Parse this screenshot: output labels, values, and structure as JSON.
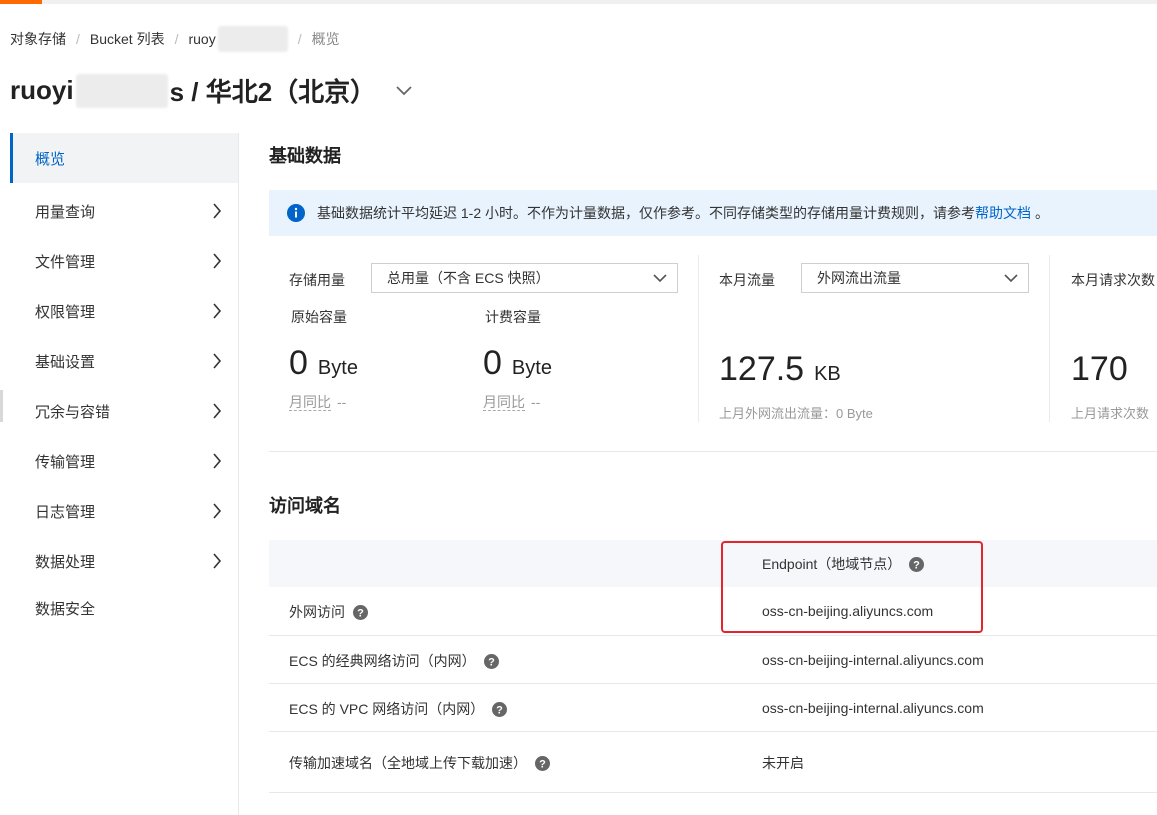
{
  "breadcrumb": {
    "items": [
      "对象存储",
      "Bucket 列表",
      "ruoy"
    ],
    "current": "概览"
  },
  "page_title": {
    "prefix": "ruoyi",
    "suffix": "s / 华北2（北京）"
  },
  "sidebar": {
    "items": [
      {
        "label": "概览",
        "active": true,
        "has_arrow": false
      },
      {
        "label": "用量查询",
        "has_arrow": true
      },
      {
        "label": "文件管理",
        "has_arrow": true
      },
      {
        "label": "权限管理",
        "has_arrow": true
      },
      {
        "label": "基础设置",
        "has_arrow": true
      },
      {
        "label": "冗余与容错",
        "has_arrow": true
      },
      {
        "label": "传输管理",
        "has_arrow": true
      },
      {
        "label": "日志管理",
        "has_arrow": true
      },
      {
        "label": "数据处理",
        "has_arrow": true
      },
      {
        "label": "数据安全",
        "has_arrow": false
      }
    ]
  },
  "basic_data": {
    "title": "基础数据",
    "notice_text": "基础数据统计平均延迟 1-2 小时。不作为计量数据，仅作参考。不同存储类型的存储用量计费规则，请参考",
    "notice_link": "帮助文档",
    "notice_end": "。",
    "storage": {
      "label": "存储用量",
      "select_value": "总用量（不含 ECS 快照）",
      "raw": {
        "label": "原始容量",
        "value": "0",
        "unit": "Byte",
        "mom_label": "月同比",
        "mom_value": "--"
      },
      "billed": {
        "label": "计费容量",
        "value": "0",
        "unit": "Byte",
        "mom_label": "月同比",
        "mom_value": "--"
      }
    },
    "traffic": {
      "label": "本月流量",
      "select_value": "外网流出流量",
      "value": "127.5",
      "unit": "KB",
      "last_month": "上月外网流出流量：0 Byte"
    },
    "requests": {
      "label": "本月请求次数",
      "value": "170",
      "last_month": "上月请求次数"
    }
  },
  "access_domain": {
    "title": "访问域名",
    "header_endpoint": "Endpoint（地域节点）",
    "rows": [
      {
        "name": "外网访问",
        "endpoint": "oss-cn-beijing.aliyuncs.com"
      },
      {
        "name": "ECS 的经典网络访问（内网）",
        "endpoint": "oss-cn-beijing-internal.aliyuncs.com"
      },
      {
        "name": "ECS 的 VPC 网络访问（内网）",
        "endpoint": "oss-cn-beijing-internal.aliyuncs.com"
      },
      {
        "name": "传输加速域名（全地域上传下载加速）",
        "endpoint": "未开启"
      }
    ]
  },
  "colors": {
    "accent": "#0064c8",
    "brand_orange": "#ff6a00",
    "highlight_red": "#e4262c",
    "notice_bg": "#e8f3fe"
  },
  "icons": [
    "info-icon",
    "help-icon",
    "chevron-right-icon",
    "chevron-down-icon"
  ]
}
